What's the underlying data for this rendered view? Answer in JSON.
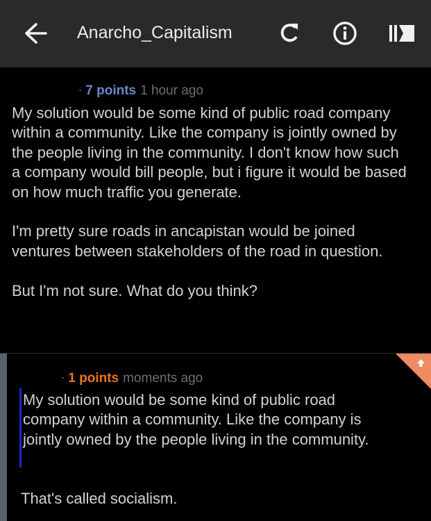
{
  "app_bar": {
    "title": "Anarcho_Capitalism",
    "back_icon": "arrow-left-icon",
    "refresh_icon": "refresh-icon",
    "info_icon": "info-icon",
    "sidebar_icon": "sidebar-icon"
  },
  "colors": {
    "app_bar_bg": "#2a2a2a",
    "background": "#000000",
    "score_blue": "#6986c8",
    "score_orange": "#e8761a",
    "upvote_badge": "#ee8a64",
    "depth_bar": "#58606e",
    "quote_bar": "#1b27c6"
  },
  "comments": [
    {
      "arrow": "⁃",
      "score": "7 points",
      "time": "1 hour ago",
      "paragraphs": [
        "My solution would be some kind of public road company within a community. Like the company is jointly owned by the people living in the community. I don't know how such a company would bill people, but i figure it would be based on how much traffic you generate.",
        "I'm pretty sure roads in ancapistan would be joined ventures between stakeholders of the road in question.",
        "But I'm not sure. What do you think?"
      ]
    },
    {
      "arrow": "⁃",
      "score": "1 points",
      "time": "moments ago",
      "quote": "My solution would be some kind of public road company within a community. Like the company is jointly owned by the people living in the community.",
      "text": "That's called socialism.",
      "upvoted_icon": "upvote-arrow-icon"
    }
  ]
}
